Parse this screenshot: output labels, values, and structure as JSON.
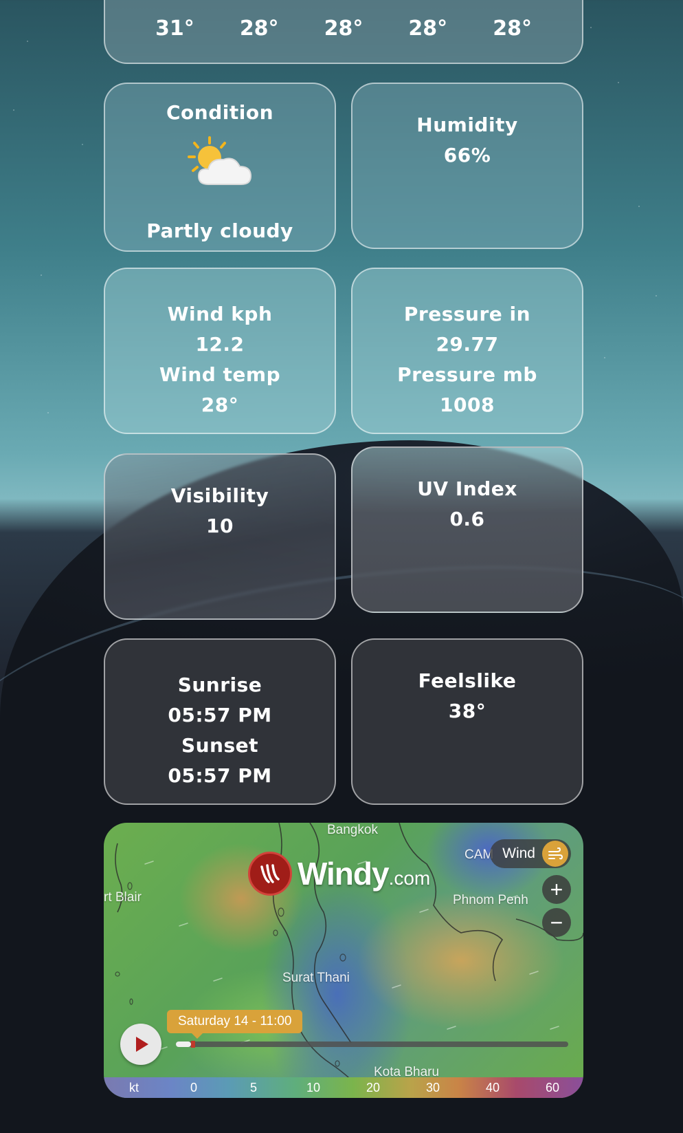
{
  "forecast": {
    "temps": [
      "31°",
      "28°",
      "28°",
      "28°",
      "28°"
    ]
  },
  "condition": {
    "title": "Condition",
    "text": "Partly cloudy",
    "icon": "partly-cloudy-icon"
  },
  "humidity": {
    "title": "Humidity",
    "value": "66%"
  },
  "wind": {
    "title": "Wind kph",
    "value": "12.2",
    "temp_title": "Wind temp",
    "temp_value": "28°"
  },
  "pressure": {
    "title": "Pressure in",
    "value": "29.77",
    "mb_title": "Pressure mb",
    "mb_value": "1008"
  },
  "visibility": {
    "title": "Visibility",
    "value": "10"
  },
  "uv": {
    "title": "UV Index",
    "value": "0.6"
  },
  "sun": {
    "sunrise_title": "Sunrise",
    "sunrise": "05:57 PM",
    "sunset_title": "Sunset",
    "sunset": "05:57 PM"
  },
  "feelslike": {
    "title": "Feelslike",
    "value": "38°"
  },
  "windy": {
    "logo_text": "Windy",
    "logo_suffix": ".com",
    "layer_label": "Wind",
    "zoom_in": "+",
    "zoom_out": "−",
    "date": "Saturday 14 - 11:00",
    "timeline_progress": 0.038,
    "places": {
      "bangkok": "Bangkok",
      "port_blair": "rt Blair",
      "phnom_penh": "Phnom Penh",
      "cam": "CAM",
      "surat_thani": "Surat Thani",
      "kota_bharu": "Kota Bharu"
    },
    "scale": {
      "unit": "kt",
      "ticks": [
        "0",
        "5",
        "10",
        "20",
        "30",
        "40",
        "60"
      ]
    }
  }
}
